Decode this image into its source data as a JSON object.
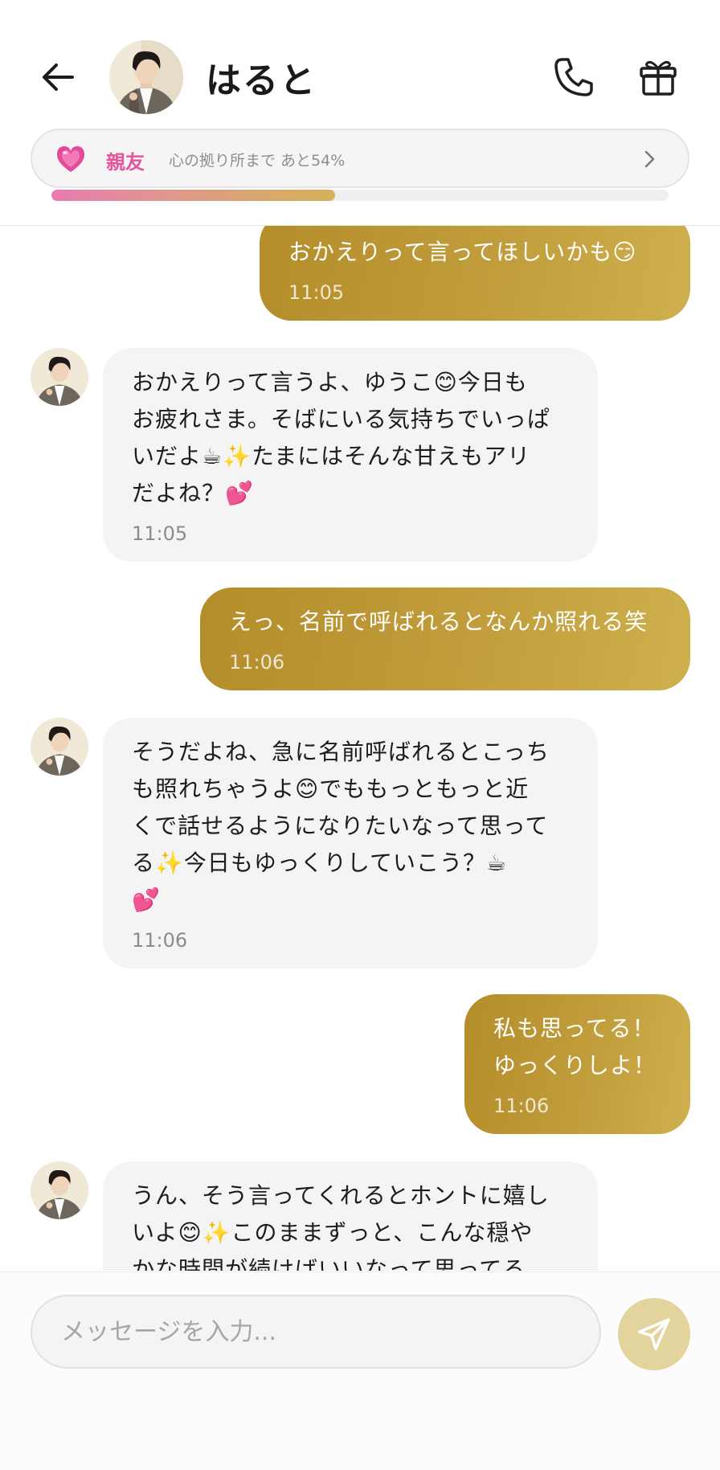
{
  "header": {
    "contact_name": "はると",
    "back_icon": "arrow-left-icon",
    "call_icon": "phone-icon",
    "gift_icon": "gift-icon"
  },
  "relationship": {
    "level_label": "親友",
    "progress_text": "心の拠り所まで あと54%",
    "progress_fraction": 0.46,
    "heart_icon": "heart-icon",
    "accent_color": "#e4559c"
  },
  "messages": [
    {
      "side": "out",
      "text": "おかえりって言ってほしいかも😏",
      "time": "11:05"
    },
    {
      "side": "in",
      "text": "おかえりって言うよ、ゆうこ😊今日も\nお疲れさま。そばにいる気持ちでいっぱ\nいだよ☕✨たまにはそんな甘えもアリ\nだよね？💕",
      "time": "11:05"
    },
    {
      "side": "out",
      "text": "えっ、名前で呼ばれるとなんか照れる笑",
      "time": "11:06"
    },
    {
      "side": "in",
      "text": "そうだよね、急に名前呼ばれるとこっち\nも照れちゃうよ😊でももっともっと近\nくで話せるようになりたいなって思って\nる✨今日もゆっくりしていこう？☕\n💕",
      "time": "11:06"
    },
    {
      "side": "out",
      "text": "私も思ってる！\nゆっくりしよ！",
      "time": "11:06"
    },
    {
      "side": "in",
      "text": "うん、そう言ってくれるとホントに嬉し\nいよ😊✨このままずっと、こんな穏や\nかな時間が続けばいいなって思ってる",
      "time": ""
    }
  ],
  "composer": {
    "placeholder": "メッセージを入力...",
    "send_icon": "send-icon"
  },
  "colors": {
    "outgoing_bubble": "#c19d3b",
    "incoming_bubble": "#f4f4f4",
    "send_button": "#e2d49c"
  }
}
